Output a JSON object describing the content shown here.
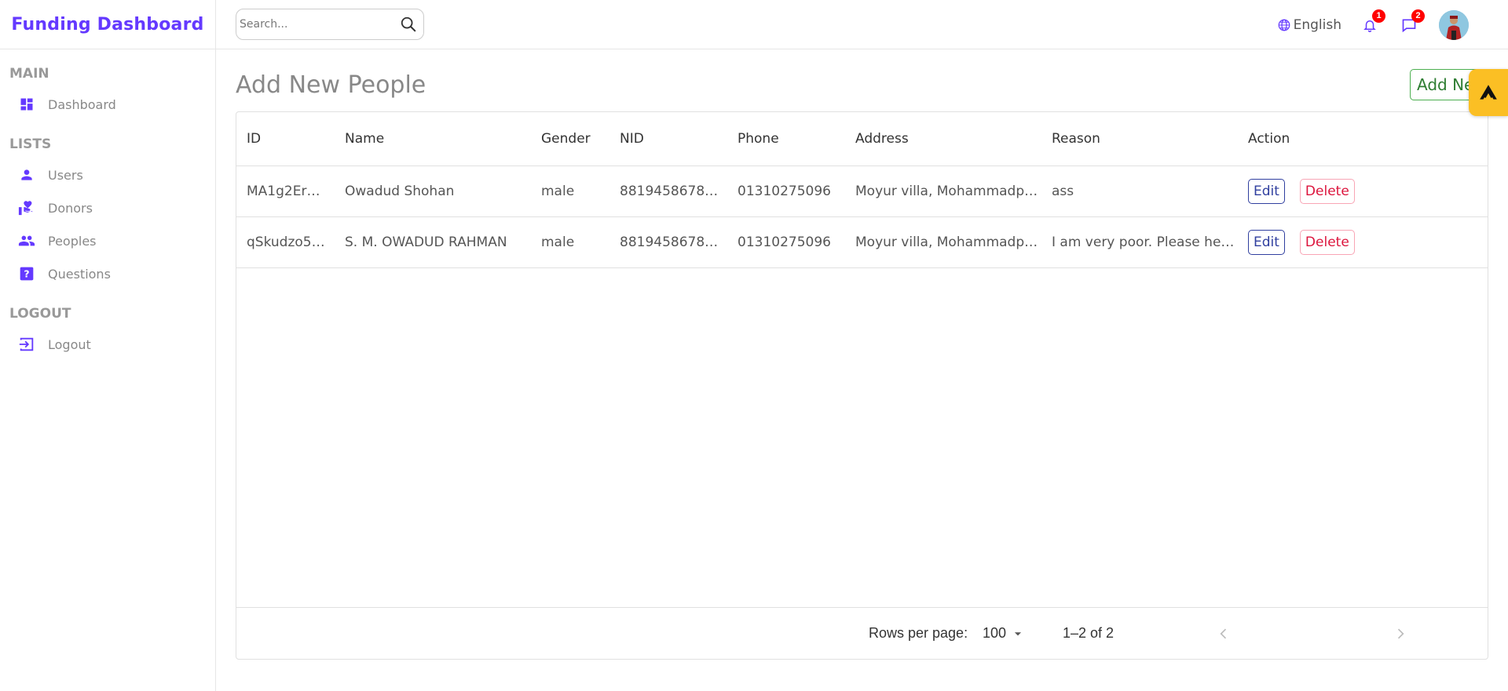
{
  "app": {
    "title": "Funding Dashboard"
  },
  "sidebar": {
    "sections": [
      {
        "title": "MAIN",
        "items": [
          {
            "label": "Dashboard",
            "icon": "dashboard-icon"
          }
        ]
      },
      {
        "title": "LISTS",
        "items": [
          {
            "label": "Users",
            "icon": "person-icon"
          },
          {
            "label": "Donors",
            "icon": "volunteer-hand-heart-icon"
          },
          {
            "label": "Peoples",
            "icon": "people-icon"
          },
          {
            "label": "Questions",
            "icon": "question-box-icon"
          }
        ]
      },
      {
        "title": "LOGOUT",
        "items": [
          {
            "label": "Logout",
            "icon": "logout-icon"
          }
        ]
      }
    ],
    "accent": "#6439ff"
  },
  "topbar": {
    "search": {
      "placeholder": "Search...",
      "value": ""
    },
    "language": "English",
    "notifications": {
      "count": "1"
    },
    "messages": {
      "count": "2"
    }
  },
  "main": {
    "title": "Add New People",
    "add_button_label": "Add New",
    "table": {
      "columns": [
        "ID",
        "Name",
        "Gender",
        "NID",
        "Phone",
        "Address",
        "Reason",
        "Action"
      ],
      "rows": [
        {
          "id": "MA1g2Er…",
          "name": "Owadud Shohan",
          "gender": "male",
          "nid": "8819458678…",
          "phone": "01310275096",
          "address": "Moyur villa, Mohammadp…",
          "reason": "ass",
          "edit": "Edit",
          "delete": "Delete"
        },
        {
          "id": "qSkudzo5…",
          "name": "S. M. OWADUD RAHMAN",
          "gender": "male",
          "nid": "8819458678…",
          "phone": "01310275096",
          "address": "Moyur villa, Mohammadp…",
          "reason": "I am very poor. Please hel…",
          "edit": "Edit",
          "delete": "Delete"
        }
      ]
    },
    "pagination": {
      "rows_per_page_label": "Rows per page:",
      "rows_per_page_value": "100",
      "range": "1–2 of 2"
    }
  },
  "colors": {
    "accent": "#6439ff",
    "add_button": "#2e7d32",
    "edit": "#303f9f",
    "delete": "#dc143c",
    "badge": "#ff0000",
    "float_tab": "#fbbf24"
  }
}
